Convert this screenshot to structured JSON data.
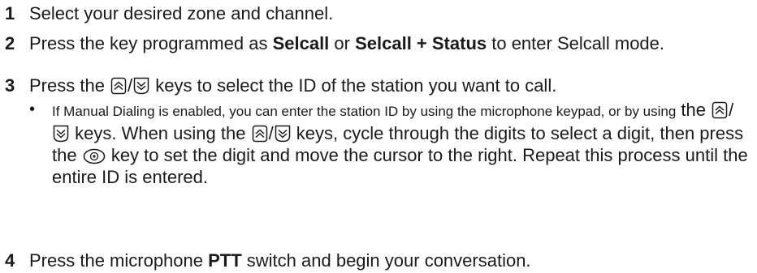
{
  "steps": [
    {
      "number": "1",
      "text": "Select your desired zone and channel."
    },
    {
      "number": "2",
      "pre": "Press the key programmed as ",
      "b1": "Selcall",
      "mid": " or ",
      "b2": "Selcall + Status",
      "post": " to enter Selcall mode."
    },
    {
      "number": "3",
      "pre": "Press the ",
      "sep": "/",
      "post": " keys to select the ID of the station you want to call."
    },
    {
      "number": "4",
      "pre": "Press the microphone ",
      "bold": "PTT",
      "post": " switch and begin your conversation."
    }
  ],
  "bullet": {
    "small_text": "If Manual Dialing is enabled, you can enter the station ID by using the microphone keypad, or by using",
    "t1": " the ",
    "sep": "/",
    "t2": " keys.  When using the ",
    "t3": " keys, cycle through the digits to select a digit, then press the ",
    "t4": " key to set the digit and move the cursor to the right.  Repeat this process until the entire ID is entered."
  },
  "icons": {
    "up": "up-key-icon",
    "down": "down-key-icon",
    "menu": "menu-select-key-icon"
  }
}
